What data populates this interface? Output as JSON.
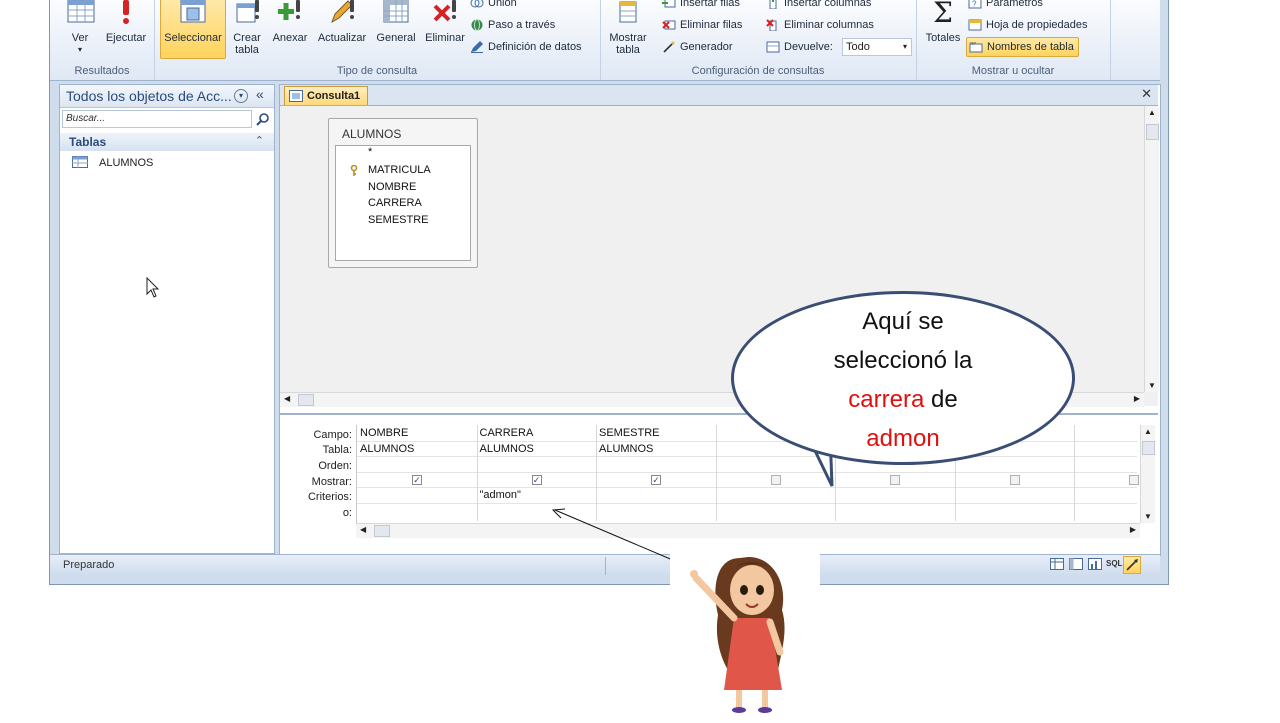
{
  "ribbon": {
    "results_group": {
      "title": "Resultados",
      "ver": "Ver",
      "ejecutar": "Ejecutar"
    },
    "query_type_group": {
      "title": "Tipo de consulta",
      "seleccionar": "Seleccionar",
      "crear_tabla_1": "Crear",
      "crear_tabla_2": "tabla",
      "anexar": "Anexar",
      "actualizar": "Actualizar",
      "general": "General",
      "eliminar": "Eliminar",
      "union": "Unión",
      "paso_a_traves": "Paso a través",
      "definicion_datos": "Definición de datos"
    },
    "setup_group": {
      "title": "Configuración de consultas",
      "mostrar_tabla_1": "Mostrar",
      "mostrar_tabla_2": "tabla",
      "insertar_filas": "Insertar filas",
      "eliminar_filas": "Eliminar filas",
      "generador": "Generador",
      "insertar_columnas": "Insertar columnas",
      "eliminar_columnas": "Eliminar columnas",
      "devuelve_label": "Devuelve:",
      "devuelve_value": "Todo"
    },
    "show_hide_group": {
      "title": "Mostrar u ocultar",
      "totales": "Totales",
      "parametros": "Parámetros",
      "hoja_propiedades": "Hoja de propiedades",
      "nombres_tabla": "Nombres de tabla"
    }
  },
  "nav_pane": {
    "title": "Todos los objetos de Acc...",
    "search_placeholder": "Buscar...",
    "section": "Tablas",
    "items": [
      "ALUMNOS"
    ]
  },
  "document": {
    "tab_label": "Consulta1",
    "table_box": {
      "name": "ALUMNOS",
      "fields": [
        "*",
        "MATRICULA",
        "NOMBRE",
        "CARRERA",
        "SEMESTRE"
      ]
    },
    "grid": {
      "row_labels": [
        "Campo:",
        "Tabla:",
        "Orden:",
        "Mostrar:",
        "Criterios:",
        "o:"
      ],
      "columns": [
        {
          "campo": "NOMBRE",
          "tabla": "ALUMNOS",
          "mostrar": true,
          "criterios": ""
        },
        {
          "campo": "CARRERA",
          "tabla": "ALUMNOS",
          "mostrar": true,
          "criterios": "\"admon\""
        },
        {
          "campo": "SEMESTRE",
          "tabla": "ALUMNOS",
          "mostrar": true,
          "criterios": ""
        },
        {
          "campo": "",
          "tabla": "",
          "mostrar": false,
          "criterios": ""
        },
        {
          "campo": "",
          "tabla": "",
          "mostrar": false,
          "criterios": ""
        },
        {
          "campo": "",
          "tabla": "",
          "mostrar": false,
          "criterios": ""
        },
        {
          "campo": "",
          "tabla": "",
          "mostrar": false,
          "criterios": ""
        }
      ]
    }
  },
  "status_bar": {
    "text": "Preparado",
    "sql_label": "SQL"
  },
  "callout": {
    "line1": "Aquí se",
    "line2": "seleccionó la",
    "line3a": "carrera",
    "line3b": " de",
    "line4": "admon"
  },
  "colors": {
    "highlight": "#e01010",
    "ribbon_selected": "#ffd35c",
    "bubble_border": "#3a4d74"
  }
}
